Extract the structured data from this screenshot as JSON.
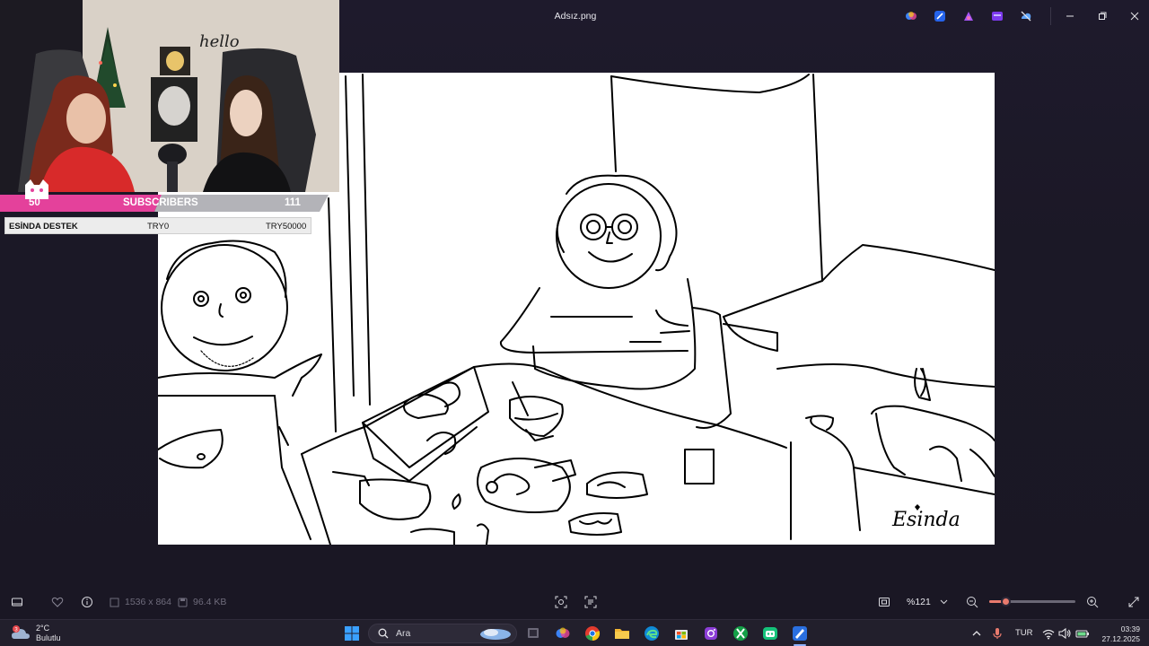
{
  "viewer": {
    "file_name": "Adsız.png",
    "dimensions": "1536 x 864",
    "file_size": "96.4 KB",
    "zoom": "%121",
    "zoom_level_percent": 121,
    "slider_position": 0.19
  },
  "stream_overlay": {
    "left_count": "50",
    "label": "SUBSCRIBERS",
    "right_count": "111",
    "donation": {
      "name": "ESİNDA DESTEK",
      "current": "TRY0",
      "goal": "TRY50000"
    },
    "wall_text": "hello",
    "accent_color": "#e4419b"
  },
  "drawing": {
    "signature": "Esinda"
  },
  "taskbar": {
    "weather_temp": "2°C",
    "weather_desc": "Bulutlu",
    "weather_badge": "3",
    "search_placeholder": "Ara",
    "language": "TUR",
    "time": "03:39",
    "date": "27.12.2025",
    "apps": [
      "start-icon",
      "search-icon",
      "task-view-icon",
      "copilot-icon",
      "chrome-icon",
      "file-explorer-icon",
      "edge-icon",
      "store-icon",
      "instagram-icon",
      "xbox-icon",
      "discord-icon",
      "photos-icon"
    ]
  }
}
